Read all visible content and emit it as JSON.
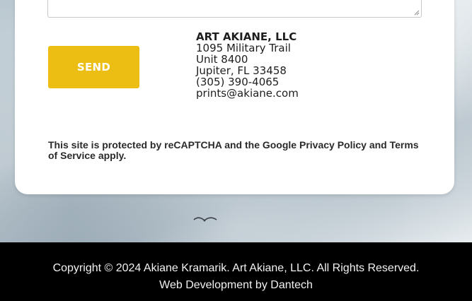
{
  "form": {
    "send_label": "SEND"
  },
  "address": {
    "company": "ART AKIANE, LLC",
    "street": "1095 Military Trail",
    "unit": "Unit 8400",
    "city": "Jupiter, FL 33458",
    "phone": "(305) 390-4065",
    "email": "prints@akiane.com"
  },
  "recaptcha": {
    "prefix": "This site is protected by reCAPTCHA and the Google ",
    "privacy_link": "Privacy Policy",
    "and": " and ",
    "terms_link": "Terms of Service",
    "suffix": " apply."
  },
  "footer": {
    "copyright": "Copyright © 2024 Akiane Kramarik. Art Akiane, LLC. All Rights Reserved.",
    "credit_prefix": "Web Development by ",
    "credit_link": "Dantech"
  },
  "colors": {
    "accent": "#ecbd13",
    "footer_bg": "#000000"
  }
}
